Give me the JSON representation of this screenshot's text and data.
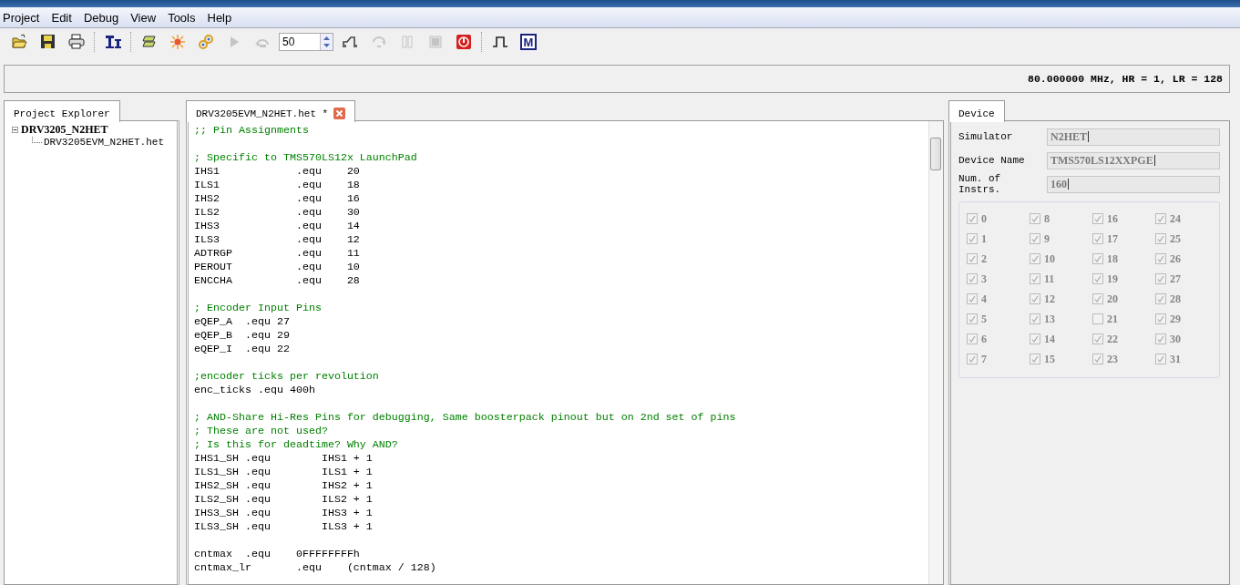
{
  "menu": [
    {
      "label": "Project"
    },
    {
      "label": "Edit"
    },
    {
      "label": "Debug"
    },
    {
      "label": "View"
    },
    {
      "label": "Tools"
    },
    {
      "label": "Help"
    }
  ],
  "toolbar": {
    "items": [
      {
        "kind": "open",
        "disabled": false
      },
      {
        "kind": "save",
        "disabled": false
      },
      {
        "kind": "print",
        "disabled": false
      },
      {
        "kind": "separator"
      },
      {
        "kind": "ibeam",
        "disabled": false
      },
      {
        "kind": "separator"
      },
      {
        "kind": "assemble",
        "disabled": false
      },
      {
        "kind": "burst",
        "disabled": false
      },
      {
        "kind": "links",
        "disabled": false
      },
      {
        "kind": "run",
        "disabled": true
      },
      {
        "kind": "step-back",
        "disabled": true
      },
      {
        "kind": "spin",
        "value": "50"
      },
      {
        "kind": "ramp",
        "disabled": false
      },
      {
        "kind": "step-over",
        "disabled": true
      },
      {
        "kind": "pause",
        "disabled": true
      },
      {
        "kind": "stop",
        "disabled": true
      },
      {
        "kind": "halt",
        "disabled": false
      },
      {
        "kind": "separator"
      },
      {
        "kind": "pulse",
        "disabled": false
      },
      {
        "kind": "letter",
        "text": "M",
        "disabled": false
      }
    ]
  },
  "info_bar": {
    "text": "80.000000 MHz, HR = 1, LR = 128"
  },
  "project_explorer": {
    "tab": {
      "label": "Project Explorer",
      "selected": true
    },
    "tree": [
      {
        "label": "DRV3205_N2HET",
        "expanded": true,
        "children": [
          {
            "label": "DRV3205EVM_N2HET.het"
          }
        ]
      }
    ]
  },
  "editor": {
    "tab": {
      "label": "DRV3205EVM_N2HET.het *",
      "selected": true
    },
    "lines": [
      {
        "kind": "comment",
        "text": ";; Pin Assignments"
      },
      {
        "kind": "blank"
      },
      {
        "kind": "comment",
        "text": "; Specific to TMS570LS12x LaunchPad"
      },
      {
        "kind": "code",
        "text": "IHS1            .equ    20"
      },
      {
        "kind": "code",
        "text": "ILS1            .equ    18"
      },
      {
        "kind": "code",
        "text": "IHS2            .equ    16"
      },
      {
        "kind": "code",
        "text": "ILS2            .equ    30"
      },
      {
        "kind": "code",
        "text": "IHS3            .equ    14"
      },
      {
        "kind": "code",
        "text": "ILS3            .equ    12"
      },
      {
        "kind": "code",
        "text": "ADTRGP          .equ    11"
      },
      {
        "kind": "code",
        "text": "PEROUT          .equ    10"
      },
      {
        "kind": "code",
        "text": "ENCCHA          .equ    28"
      },
      {
        "kind": "blank"
      },
      {
        "kind": "comment",
        "text": "; Encoder Input Pins"
      },
      {
        "kind": "code",
        "text": "eQEP_A  .equ 27"
      },
      {
        "kind": "code",
        "text": "eQEP_B  .equ 29"
      },
      {
        "kind": "code",
        "text": "eQEP_I  .equ 22"
      },
      {
        "kind": "blank"
      },
      {
        "kind": "comment",
        "text": ";encoder ticks per revolution"
      },
      {
        "kind": "code",
        "text": "enc_ticks .equ 400h"
      },
      {
        "kind": "blank"
      },
      {
        "kind": "comment",
        "text": "; AND-Share Hi-Res Pins for debugging, Same boosterpack pinout but on 2nd set of pins"
      },
      {
        "kind": "comment",
        "text": "; These are not used?"
      },
      {
        "kind": "comment",
        "text": "; Is this for deadtime? Why AND?"
      },
      {
        "kind": "code",
        "text": "IHS1_SH .equ        IHS1 + 1"
      },
      {
        "kind": "code",
        "text": "ILS1_SH .equ        ILS1 + 1"
      },
      {
        "kind": "code",
        "text": "IHS2_SH .equ        IHS2 + 1"
      },
      {
        "kind": "code",
        "text": "ILS2_SH .equ        ILS2 + 1"
      },
      {
        "kind": "code",
        "text": "IHS3_SH .equ        IHS3 + 1"
      },
      {
        "kind": "code",
        "text": "ILS3_SH .equ        ILS3 + 1"
      },
      {
        "kind": "blank"
      },
      {
        "kind": "code",
        "text": "cntmax  .equ    0FFFFFFFFh"
      },
      {
        "kind": "code",
        "text": "cntmax_lr       .equ    (cntmax / 128)"
      }
    ]
  },
  "device": {
    "tab": {
      "label": "Device",
      "selected": true
    },
    "fields": [
      {
        "label": "Simulator",
        "value": "N2HET"
      },
      {
        "label": "Device Name",
        "value": "TMS570LS12XXPGE"
      },
      {
        "label": "Num. of Instrs.",
        "value": "160"
      }
    ],
    "pins": [
      {
        "label": "0",
        "checked": true,
        "disabled": true
      },
      {
        "label": "1",
        "checked": true,
        "disabled": true
      },
      {
        "label": "2",
        "checked": true,
        "disabled": true
      },
      {
        "label": "3",
        "checked": true,
        "disabled": true
      },
      {
        "label": "4",
        "checked": true,
        "disabled": true
      },
      {
        "label": "5",
        "checked": true,
        "disabled": true
      },
      {
        "label": "6",
        "checked": true,
        "disabled": true
      },
      {
        "label": "7",
        "checked": true,
        "disabled": true
      },
      {
        "label": "8",
        "checked": true,
        "disabled": true
      },
      {
        "label": "9",
        "checked": true,
        "disabled": true
      },
      {
        "label": "10",
        "checked": true,
        "disabled": true
      },
      {
        "label": "11",
        "checked": true,
        "disabled": true
      },
      {
        "label": "12",
        "checked": true,
        "disabled": true
      },
      {
        "label": "13",
        "checked": true,
        "disabled": true
      },
      {
        "label": "14",
        "checked": true,
        "disabled": true
      },
      {
        "label": "15",
        "checked": true,
        "disabled": true
      },
      {
        "label": "16",
        "checked": true,
        "disabled": true
      },
      {
        "label": "17",
        "checked": true,
        "disabled": true
      },
      {
        "label": "18",
        "checked": true,
        "disabled": true
      },
      {
        "label": "19",
        "checked": true,
        "disabled": true
      },
      {
        "label": "20",
        "checked": true,
        "disabled": true
      },
      {
        "label": "21",
        "checked": false,
        "disabled": true
      },
      {
        "label": "22",
        "checked": true,
        "disabled": true
      },
      {
        "label": "23",
        "checked": true,
        "disabled": true
      },
      {
        "label": "24",
        "checked": true,
        "disabled": true
      },
      {
        "label": "25",
        "checked": true,
        "disabled": true
      },
      {
        "label": "26",
        "checked": true,
        "disabled": true
      },
      {
        "label": "27",
        "checked": true,
        "disabled": true
      },
      {
        "label": "28",
        "checked": true,
        "disabled": true
      },
      {
        "label": "29",
        "checked": true,
        "disabled": true
      },
      {
        "label": "30",
        "checked": true,
        "disabled": true
      },
      {
        "label": "31",
        "checked": true,
        "disabled": true
      }
    ]
  }
}
